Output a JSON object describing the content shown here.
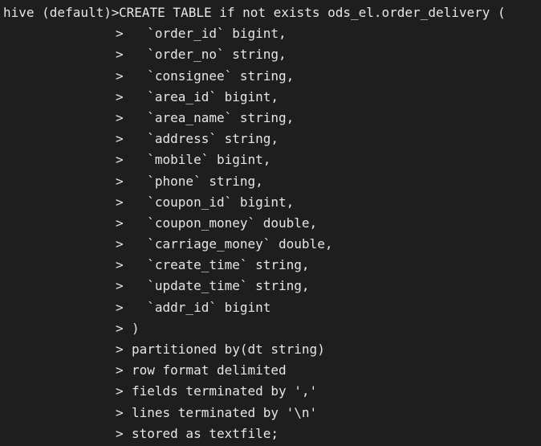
{
  "terminal": {
    "prompt": "hive (default)>",
    "continuation": ">",
    "lines": [
      "CREATE TABLE if not exists ods_el.order_delivery (",
      "  `order_id` bigint,",
      "  `order_no` string,",
      "  `consignee` string,",
      "  `area_id` bigint,",
      "  `area_name` string,",
      "  `address` string,",
      "  `mobile` bigint,",
      "  `phone` string,",
      "  `coupon_id` bigint,",
      "  `coupon_money` double,",
      "  `carriage_money` double,",
      "  `create_time` string,",
      "  `update_time` string,",
      "  `addr_id` bigint",
      ")",
      "partitioned by(dt string)",
      "row format delimited",
      "fields terminated by ','",
      "lines terminated by '\\n'",
      "stored as textfile;"
    ]
  },
  "colors": {
    "background": "#1e1e1e",
    "foreground": "#e6e6e6"
  }
}
